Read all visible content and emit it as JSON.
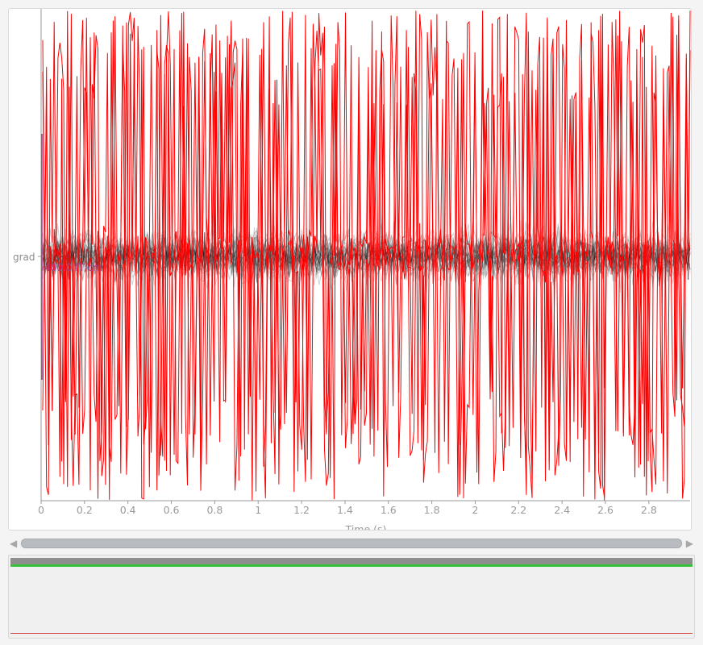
{
  "plot": {
    "channel_label": "grad",
    "scale_label": "400.0 fT/cm",
    "xlabel": "Time (s)",
    "colors": {
      "good_channels": "#000000",
      "bad_channels": "#ff0000",
      "scale_text": "#b03a8a",
      "axis": "#9a9a9a"
    }
  },
  "chart_data": {
    "type": "line",
    "title": "",
    "xlabel": "Time (s)",
    "ylabel": "",
    "xlim": [
      0,
      2.99
    ],
    "x_ticks": [
      "0",
      "0.2",
      "0.4",
      "0.6",
      "0.8",
      "1",
      "1.2",
      "1.4",
      "1.6",
      "1.8",
      "2",
      "2.2",
      "2.4",
      "2.6",
      "2.8"
    ],
    "y_ticks": [
      "grad"
    ],
    "grid": false,
    "series": [
      {
        "values_description_note": "",
        "color": "#000000"
      },
      {
        "color": "#ff0000"
      }
    ]
  },
  "scrollbar": {
    "left_arrow": "◀",
    "right_arrow": "▶",
    "position": 0.0
  },
  "overview": {
    "colors": {
      "bar": "#8e8e8e",
      "marker": "#35c23a",
      "line": "#d23a3a"
    }
  }
}
